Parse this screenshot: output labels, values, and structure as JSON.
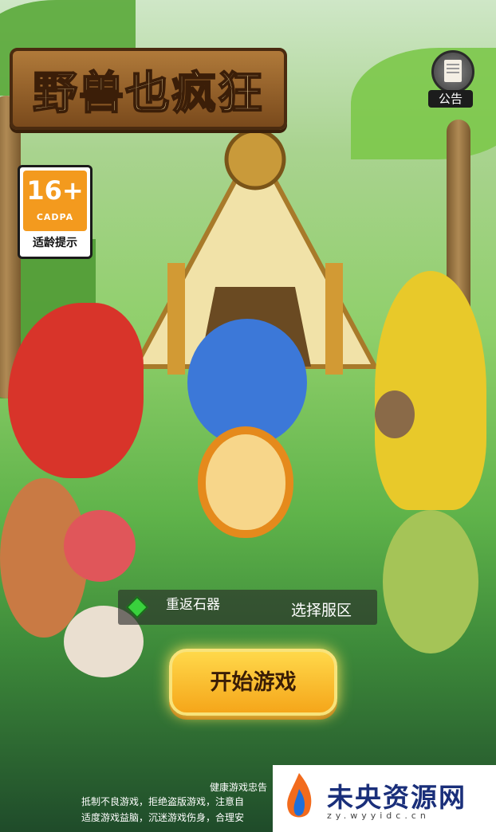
{
  "game": {
    "title": "野兽也疯狂"
  },
  "notice": {
    "label": "公告",
    "icon": "notice-scroll-icon"
  },
  "age_rating": {
    "age": "16+",
    "org": "CADPA",
    "tip": "适龄提示"
  },
  "server": {
    "icon": "green-gem-icon",
    "name": "重返石器",
    "select_label": "选择服区"
  },
  "start_button": {
    "label": "开始游戏"
  },
  "health_notice": {
    "title": "健康游戏忠告",
    "lines": [
      "抵制不良游戏，拒绝盗版游戏，注意自",
      "适度游戏益脑，沉迷游戏伤身，合理安"
    ]
  },
  "watermark": {
    "text": "未央资源网",
    "url": "zy.wyyidc.cn"
  },
  "colors": {
    "accent_gold": "#f5a61a",
    "age_orange": "#f39a1e",
    "server_gem": "#39d13d"
  }
}
